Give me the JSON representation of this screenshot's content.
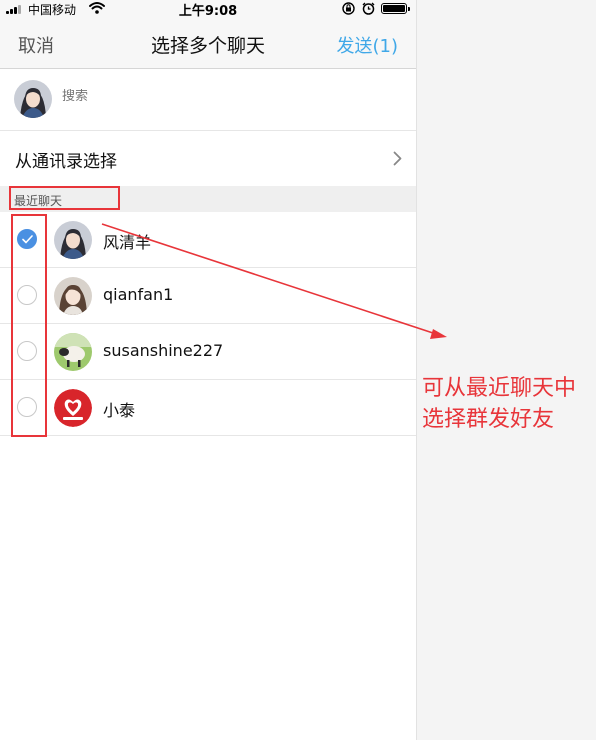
{
  "status_bar": {
    "carrier": "中国移动",
    "time": "上午9:08",
    "battery_level": 1.0
  },
  "nav": {
    "cancel_label": "取消",
    "title": "选择多个聊天",
    "send_label": "发送(1)"
  },
  "search": {
    "placeholder": "搜索"
  },
  "contacts_entry": {
    "label": "从通讯录选择"
  },
  "recent_section": {
    "label": "最近聊天"
  },
  "chats": [
    {
      "name": "风清羊",
      "checked": true,
      "avatar": "girl-portrait-avatar"
    },
    {
      "name": "qianfan1",
      "checked": false,
      "avatar": "girl-portrait-avatar"
    },
    {
      "name": "susanshine227",
      "checked": false,
      "avatar": "sheep-photo-avatar"
    },
    {
      "name": "小泰",
      "checked": false,
      "avatar": "red-heart-logo-avatar"
    }
  ],
  "annotation": {
    "line1": "可从最近聊天中",
    "line2": "选择群发好友"
  },
  "colors": {
    "accent_blue": "#40a8e8",
    "check_blue": "#4a90e2",
    "annotation_red": "#e8353a"
  }
}
